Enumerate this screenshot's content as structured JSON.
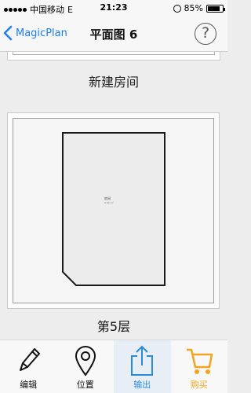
{
  "status_bar": {
    "carrier": "中国移动",
    "network": "E",
    "time": "21:23",
    "battery": "85%",
    "battery_level": 0.85
  },
  "nav": {
    "back_label": "MagicPlan",
    "title": "平面图 6",
    "help_label": "?"
  },
  "content": {
    "new_room_label": "新建房间",
    "floor_label": "第5层",
    "room_name": "房间",
    "room_area": "0.00 m²"
  },
  "tabs": [
    {
      "label": "编辑",
      "icon": "pencil-icon"
    },
    {
      "label": "位置",
      "icon": "map-pin-icon"
    },
    {
      "label": "输出",
      "icon": "share-export-icon"
    },
    {
      "label": "购买",
      "icon": "shopping-cart-icon"
    }
  ],
  "colors": {
    "accent_blue": "#1e7cf0",
    "export_blue": "#2a8bd8",
    "buy_orange": "#f2a421"
  }
}
